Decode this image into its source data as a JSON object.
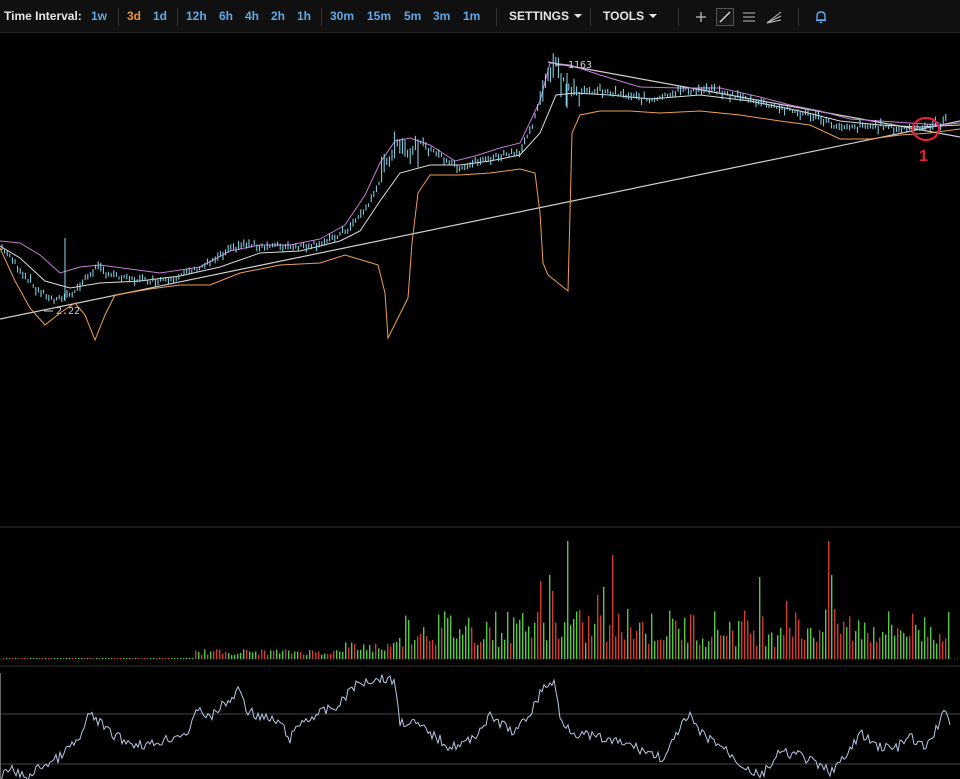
{
  "toolbar": {
    "time_interval_label": "Time Interval:",
    "intervals": [
      "1w",
      "3d",
      "1d",
      "12h",
      "6h",
      "4h",
      "2h",
      "1h",
      "30m",
      "15m",
      "5m",
      "3m",
      "1m"
    ],
    "active_interval": "3d",
    "settings_label": "SETTINGS",
    "tools_label": "TOOLS",
    "icons": [
      "crosshair-icon",
      "trendline-icon",
      "horizontal-lines-icon",
      "fan-icon",
      "alert-bell-icon"
    ]
  },
  "chart": {
    "high_price_label": "1163",
    "low_price_label": "2.22",
    "annotation_label": "1",
    "colors": {
      "background": "#000000",
      "candles": "#8fdcf0",
      "upper_band": "#c77ad8",
      "lower_band": "#f0a050",
      "moving_average": "#dddddd",
      "trendline": "#cfcfcf",
      "volume_up": "#56c843",
      "volume_down": "#d23b32",
      "oscillator": "#b8c8e8",
      "annotation": "#e8203a"
    }
  }
}
